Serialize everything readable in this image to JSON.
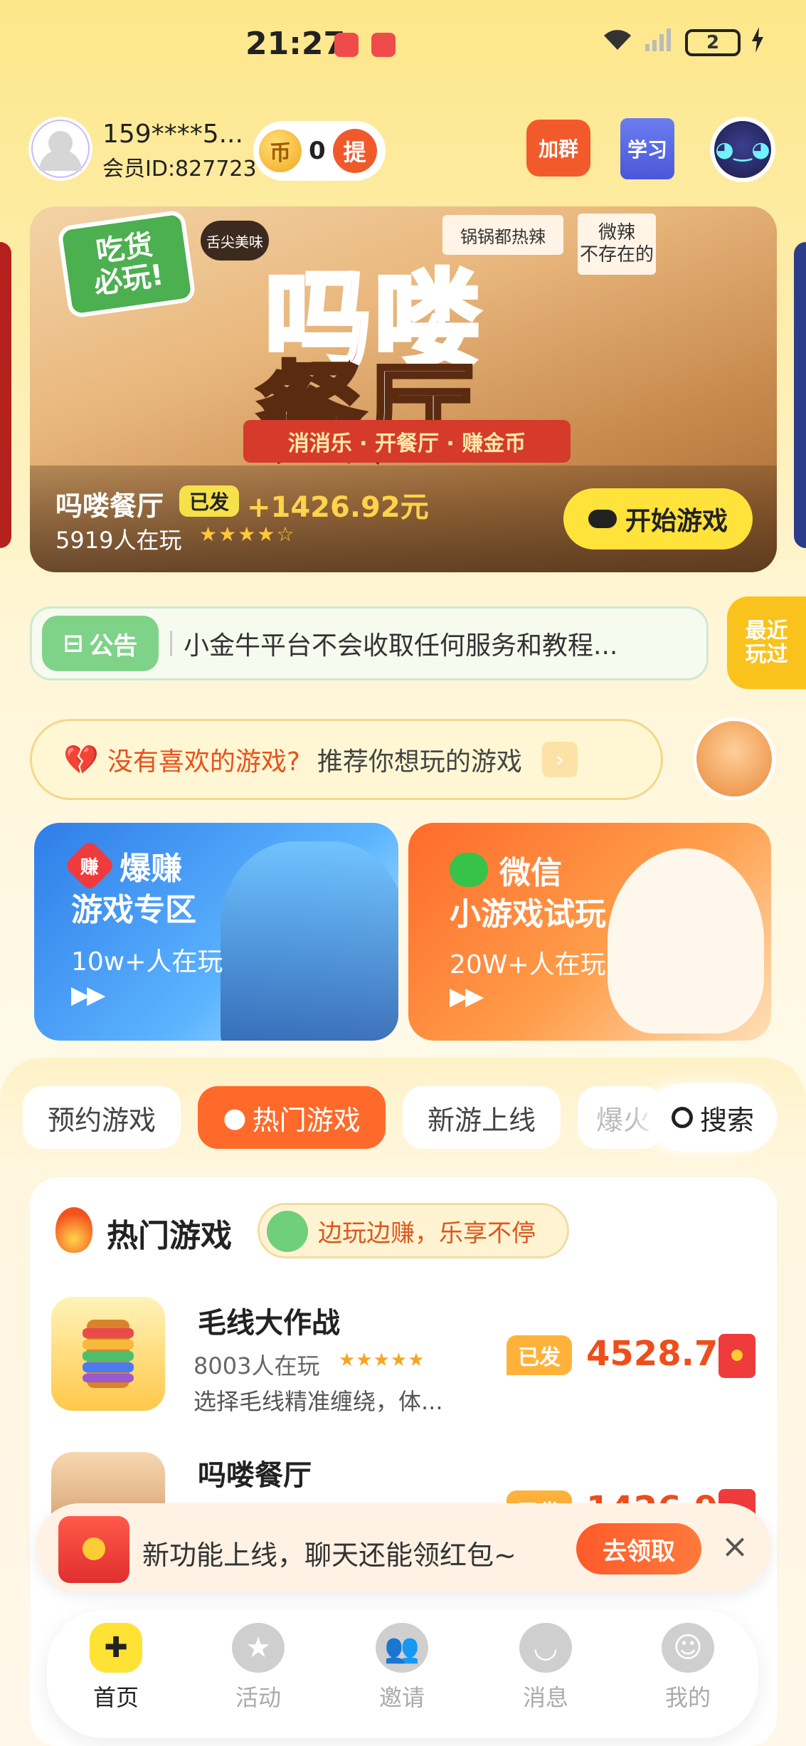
{
  "status_bar": {
    "time": "21:27",
    "battery": "2"
  },
  "header": {
    "user_phone": "159****5...",
    "member_id": "会员ID:827723",
    "coins": "0",
    "coin_icon_text": "币",
    "withdraw_icon_text": "提",
    "join_group": "加群",
    "study": "学习"
  },
  "banner": {
    "game_title": "吗喽餐厅",
    "tag": "已发",
    "amount": "+1426.92元",
    "players": "5919人在玩",
    "stars": "★★★★☆",
    "start_button": "开始游戏",
    "art_badge": "吃货\n必玩!",
    "art_logo_line1": "吗喽",
    "art_logo_line2": "餐厅",
    "art_ribbon": "消消乐 · 开餐厅 · 赚金币",
    "art_sign1": "锅锅都热辣",
    "art_sign2": "微辣\n不存在的",
    "art_sign3": "舌尖美味"
  },
  "notice": {
    "tag": "公告",
    "text": "小金牛平台不会收取任何服务和教程..."
  },
  "recent_tab": "最近\n玩过",
  "recommend": {
    "part1": "没有喜欢的游戏?",
    "part2": "推荐你想玩的游戏"
  },
  "cards": [
    {
      "title_line1": "爆赚",
      "title_line2": "游戏专区",
      "subtitle": "10w+人在玩",
      "badge": "赚"
    },
    {
      "title_line1": "微信",
      "title_line2": "小游戏试玩",
      "subtitle": "20W+人在玩"
    }
  ],
  "tabs": [
    {
      "label": "预约游戏",
      "active": false
    },
    {
      "label": "热门游戏",
      "active": true
    },
    {
      "label": "新游上线",
      "active": false
    },
    {
      "label": "爆火",
      "active": false
    }
  ],
  "search_label": "搜索",
  "hot_section": {
    "title": "热门游戏",
    "slogan": "边玩边赚，乐享不停"
  },
  "games": [
    {
      "name": "毛线大作战",
      "players": "8003人在玩",
      "stars": "★★★★★",
      "desc": "选择毛线精准缠绕，体...",
      "tag": "已发",
      "amount": "4528.74"
    },
    {
      "name": "吗喽餐厅",
      "players": "",
      "stars": "",
      "desc": "",
      "tag": "已发",
      "amount": "1426.92"
    }
  ],
  "toast": {
    "text": "新功能上线，聊天还能领红包~",
    "button": "去领取",
    "close": "×"
  },
  "bottom_nav": [
    {
      "label": "首页",
      "active": true,
      "icon": "gamepad-icon"
    },
    {
      "label": "活动",
      "active": false,
      "icon": "star-icon"
    },
    {
      "label": "邀请",
      "active": false,
      "icon": "invite-icon"
    },
    {
      "label": "消息",
      "active": false,
      "icon": "message-icon"
    },
    {
      "label": "我的",
      "active": false,
      "icon": "smile-icon"
    }
  ],
  "colors": {
    "accent_orange": "#ff6a2a",
    "accent_yellow": "#ffe23a",
    "amount_red": "#ef4e1b"
  }
}
